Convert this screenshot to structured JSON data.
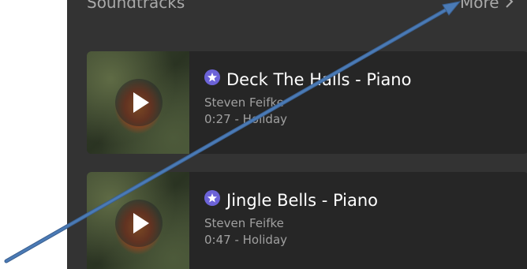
{
  "section": {
    "title": "Soundtracks",
    "more_label": "More"
  },
  "tracks": [
    {
      "title": "Deck The Halls - Piano",
      "artist": "Steven Feifke",
      "meta": "0:27 - Holiday"
    },
    {
      "title": "Jingle Bells - Piano",
      "artist": "Steven Feifke",
      "meta": "0:47 - Holiday"
    }
  ],
  "icons": {
    "play": "play-icon",
    "premium": "star-badge-icon",
    "more": "chevron-right-icon"
  },
  "colors": {
    "panel_bg": "#333333",
    "card_bg": "#262626",
    "badge": "#6c63d8",
    "annotation_arrow": "#4a7ab5"
  }
}
